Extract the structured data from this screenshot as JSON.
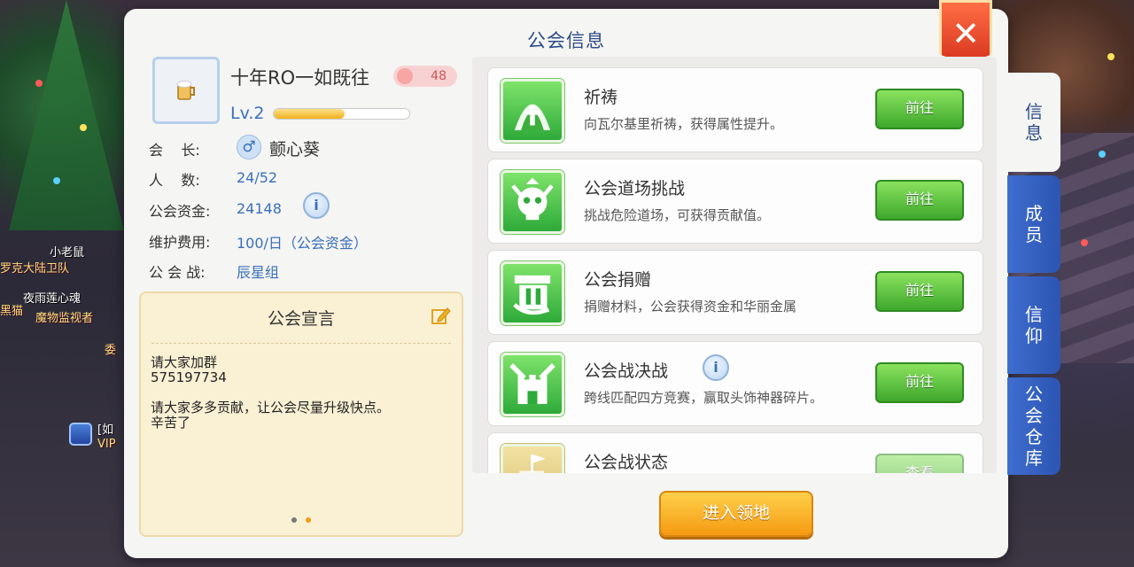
{
  "panel": {
    "title": "公会信息",
    "close_label": "✕"
  },
  "guild": {
    "name": "十年RO一如既往",
    "member_badge": "48",
    "level": "Lv.2",
    "level_progress": 0.52,
    "info": [
      {
        "label": "会    长:",
        "value": "颤心葵"
      },
      {
        "label": "人    数:",
        "value": "24/52"
      },
      {
        "label": "公会资金:",
        "value": "24148"
      },
      {
        "label": "维护费用:",
        "value": "100/日（公会资金）"
      },
      {
        "label": "公 会 战:",
        "value": "辰星组"
      }
    ]
  },
  "manifesto": {
    "title": "公会宣言",
    "text": "请大家加群\n575197734\n\n请大家多多贡献，让公会尽量升级快点。\n辛苦了"
  },
  "activities": [
    {
      "title": "祈祷",
      "desc": "向瓦尔基里祈祷，获得属性提升。",
      "button": "前往",
      "icon": "prayer-icon"
    },
    {
      "title": "公会道场挑战",
      "desc": "挑战危险道场，可获得贡献值。",
      "button": "前往",
      "icon": "skull-icon"
    },
    {
      "title": "公会捐赠",
      "desc": "捐赠材料，公会获得资金和华丽金属",
      "button": "前往",
      "icon": "donate-icon"
    },
    {
      "title": "公会战决战",
      "desc": "跨线匹配四方竞赛，赢取头饰神器碎片。",
      "button": "前往",
      "icon": "castle-icon"
    },
    {
      "title": "公会战状态",
      "desc": "",
      "button": "查看",
      "icon": "flag-castle-icon"
    }
  ],
  "enter_button": "进入领地",
  "tabs": [
    {
      "label": "信息",
      "active": true
    },
    {
      "label": "成员",
      "active": false
    },
    {
      "label": "信仰",
      "active": false
    },
    {
      "label": "公会仓库",
      "active": false
    }
  ],
  "background_text": [
    "小老鼠",
    "罗克大陆卫队",
    "夜雨莲心魂",
    "黑猫",
    "魔物监视者",
    "VIP",
    "[如",
    "委"
  ],
  "colors": {
    "accent_blue": "#2d4c86",
    "go_green": "#3ea82c",
    "enter_orange": "#f59a12",
    "close_red": "#d8361f"
  }
}
